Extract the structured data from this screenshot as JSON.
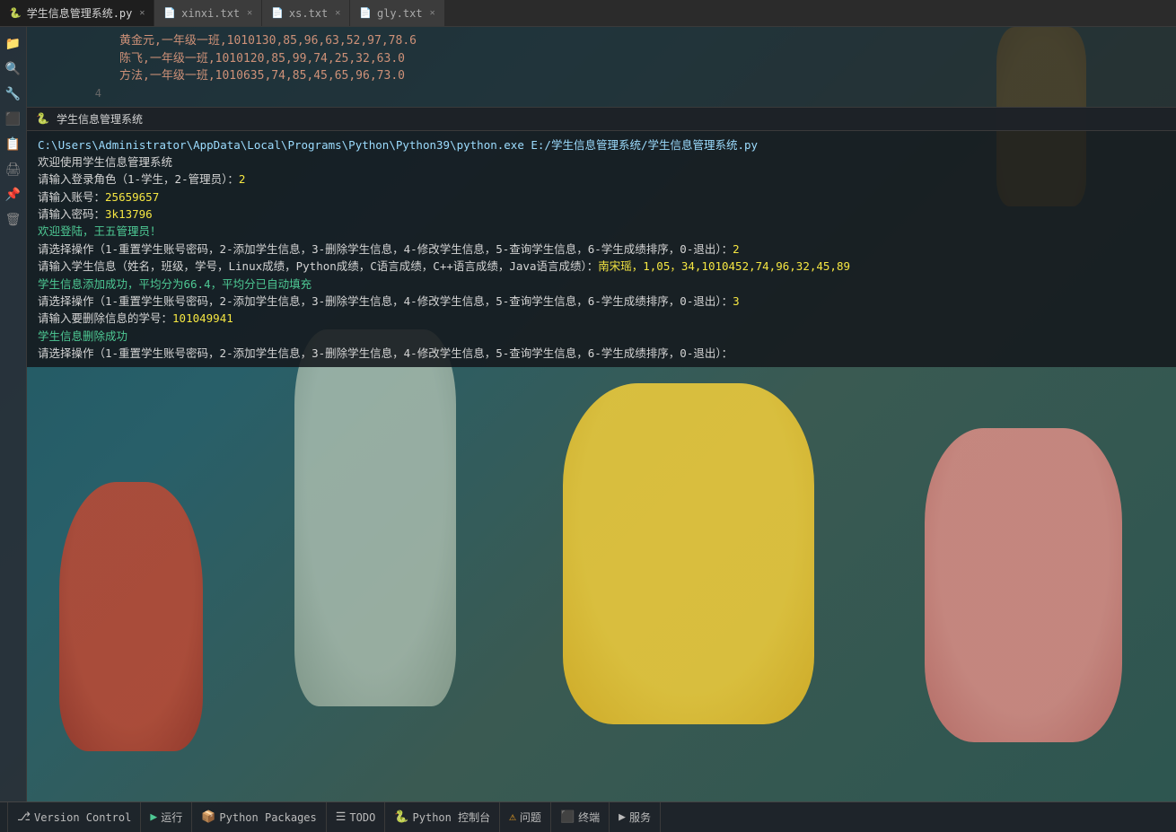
{
  "tabs": [
    {
      "label": "学生信息管理系统.py",
      "icon": "🐍",
      "active": true,
      "closable": true
    },
    {
      "label": "xinxi.txt",
      "icon": "📄",
      "active": false,
      "closable": true
    },
    {
      "label": "xs.txt",
      "icon": "📄",
      "active": false,
      "closable": true
    },
    {
      "label": "gly.txt",
      "icon": "📄",
      "active": false,
      "closable": true
    }
  ],
  "file_lines": [
    {
      "num": "",
      "content": "黄金元,一年级一班,1010130,85,96,63,52,97,78.6"
    },
    {
      "num": "",
      "content": "陈飞,一年级一班,1010120,85,99,74,25,32,63.0"
    },
    {
      "num": "",
      "content": "方法,一年级一班,1010635,74,85,45,65,96,73.0"
    },
    {
      "num": "4",
      "content": ""
    }
  ],
  "run_panel": {
    "title": "🐍 学生信息管理系统",
    "command": "C:\\Users\\Administrator\\AppData\\Local\\Programs\\Python\\Python39\\python.exe E:/学生信息管理系统/学生信息管理系统.py",
    "lines": [
      {
        "text": "欢迎使用学生信息管理系统",
        "color": "white"
      },
      {
        "text": "请输入登录角色（1-学生，2-管理员）：",
        "color": "white",
        "input": "2"
      },
      {
        "text": "请输入账号：",
        "color": "white",
        "input": "25659657"
      },
      {
        "text": "请输入密码：",
        "color": "white",
        "input": "3k13796"
      },
      {
        "text": "欢迎登陆，王五管理员！",
        "color": "green"
      },
      {
        "text": "请选择操作（1-重置学生账号密码，2-添加学生信息，3-删除学生信息，4-修改学生信息，5-查询学生信息，6-学生成绩排序，0-退出）：",
        "color": "white",
        "input": "2"
      },
      {
        "text": "请输入学生信息（姓名，班级，学号，Linux成绩，Python成绩，C语言成绩，C++语言成绩，Java语言成绩）：",
        "color": "white",
        "input": "南宋瑶，1,05，34,1010452,74,96,32,45,89"
      },
      {
        "text": "学生信息添加成功，平均分为66.4，平均分已自动填充",
        "color": "green"
      },
      {
        "text": "请选择操作（1-重置学生账号密码，2-添加学生信息，3-删除学生信息，4-修改学生信息，5-查询学生信息，6-学生成绩排序，0-退出）：",
        "color": "white",
        "input": "3"
      },
      {
        "text": "请输入要删除信息的学号：",
        "color": "white",
        "input": "101049941"
      },
      {
        "text": "学生信息删除成功",
        "color": "green"
      },
      {
        "text": "请选择操作（1-重置学生账号密码，2-添加学生信息，3-删除学生信息，4-修改学生信息，5-查询学生信息，6-学生成绩排序，0-退出）：",
        "color": "white"
      }
    ]
  },
  "statusbar": {
    "items": [
      {
        "icon": "⎇",
        "label": "Version Control",
        "id": "version-control"
      },
      {
        "icon": "▶",
        "label": "运行",
        "id": "run",
        "accent": true
      },
      {
        "icon": "📦",
        "label": "Python Packages",
        "id": "python-packages"
      },
      {
        "icon": "☰",
        "label": "TODO",
        "id": "todo"
      },
      {
        "icon": "🐍",
        "label": "Python 控制台",
        "id": "python-console"
      },
      {
        "icon": "⚠",
        "label": "问题",
        "id": "problems"
      },
      {
        "icon": "⬛",
        "label": "终端",
        "id": "terminal"
      },
      {
        "icon": "▶",
        "label": "服务",
        "id": "services"
      }
    ]
  },
  "sidebar_icons": [
    "📁",
    "🔍",
    "🔧",
    "⬛",
    "📋",
    "🖨",
    "📌",
    "🗑"
  ]
}
